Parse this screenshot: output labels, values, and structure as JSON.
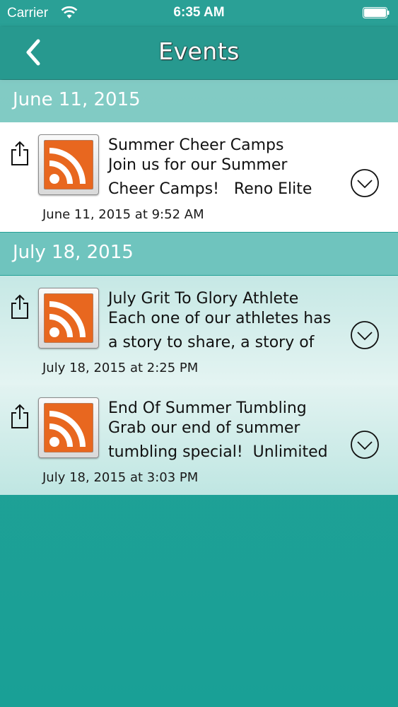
{
  "status_bar": {
    "carrier": "Carrier",
    "time": "6:35 AM"
  },
  "nav": {
    "title": "Events",
    "back_icon": "chevron-left-icon"
  },
  "sections": [
    {
      "date": "June 11, 2015",
      "items": [
        {
          "title": "Summer Cheer Camps",
          "description": "Join us for our Summer\nCheer Camps!   Reno Elite",
          "timestamp": "June 11, 2015 at 9:52 AM"
        }
      ]
    },
    {
      "date": "July 18, 2015",
      "items": [
        {
          "title": "July Grit To Glory Athlete",
          "description": "Each one of our athletes has\na story to share, a story of",
          "timestamp": "July 18, 2015 at 2:25 PM"
        },
        {
          "title": "End Of Summer Tumbling",
          "description": "Grab our end of summer\ntumbling special!  Unlimited",
          "timestamp": "July 18, 2015 at 3:03 PM"
        }
      ]
    }
  ],
  "colors": {
    "nav": "#27998f",
    "section_header": "#92d2cd",
    "rss_orange": "#e8671f",
    "background": "#1fa196"
  }
}
